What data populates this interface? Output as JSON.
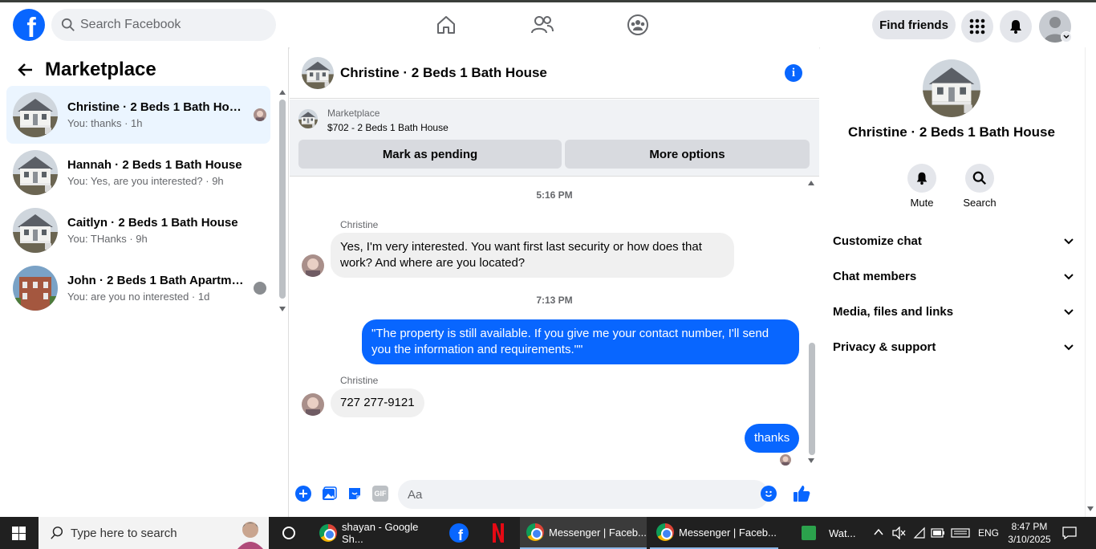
{
  "header": {
    "logo_letter": "f",
    "search_placeholder": "Search Facebook",
    "find_friends": "Find friends"
  },
  "left": {
    "title": "Marketplace",
    "conversations": [
      {
        "name": "Christine · 2 Beds 1 Bath House",
        "preview": "You: thanks · 1h",
        "active": true
      },
      {
        "name": "Hannah · 2 Beds 1 Bath House",
        "preview": "You: Yes, are you interested? · 9h",
        "active": false
      },
      {
        "name": "Caitlyn · 2 Beds 1 Bath House",
        "preview": "You: THanks · 9h",
        "active": false
      },
      {
        "name": "John · 2 Beds 1 Bath Apartme...",
        "preview": "You: are you no interested · 1d",
        "active": false
      }
    ]
  },
  "chat": {
    "title": "Christine · 2 Beds 1 Bath House",
    "marketplace_label": "Marketplace",
    "listing": "$702 - 2 Beds 1 Bath House",
    "mark_pending": "Mark as pending",
    "more_options": "More options",
    "messages": [
      {
        "type": "time",
        "text": "5:16 PM"
      },
      {
        "type": "in",
        "sender": "Christine",
        "text": "Yes, I'm very interested. You want first last security or how does that work? And where are you located?"
      },
      {
        "type": "time",
        "text": "7:13 PM"
      },
      {
        "type": "out",
        "text": "\"The property is still available. If you give me your contact number, I'll send you the information and requirements.\"\""
      },
      {
        "type": "in",
        "sender": "Christine",
        "text": "727 277-9121"
      },
      {
        "type": "out",
        "text": "thanks"
      }
    ],
    "composer_placeholder": "Aa",
    "gif_label": "GIF"
  },
  "right": {
    "name": "Christine · 2 Beds 1 Bath House",
    "mute": "Mute",
    "search": "Search",
    "sections": [
      "Customize chat",
      "Chat members",
      "Media, files and links",
      "Privacy & support"
    ]
  },
  "taskbar": {
    "search_text": "Type here to search",
    "apps": [
      {
        "label": "shayan - Google Sh..."
      },
      {
        "label": "Messenger | Faceb..."
      },
      {
        "label": "Messenger | Faceb..."
      },
      {
        "label": "Wat..."
      }
    ],
    "lang": "ENG",
    "time": "8:47 PM",
    "date": "3/10/2025"
  },
  "colors": {
    "accent": "#0866ff",
    "active_conv": "#ebf5ff",
    "taskbar": "#202020"
  }
}
